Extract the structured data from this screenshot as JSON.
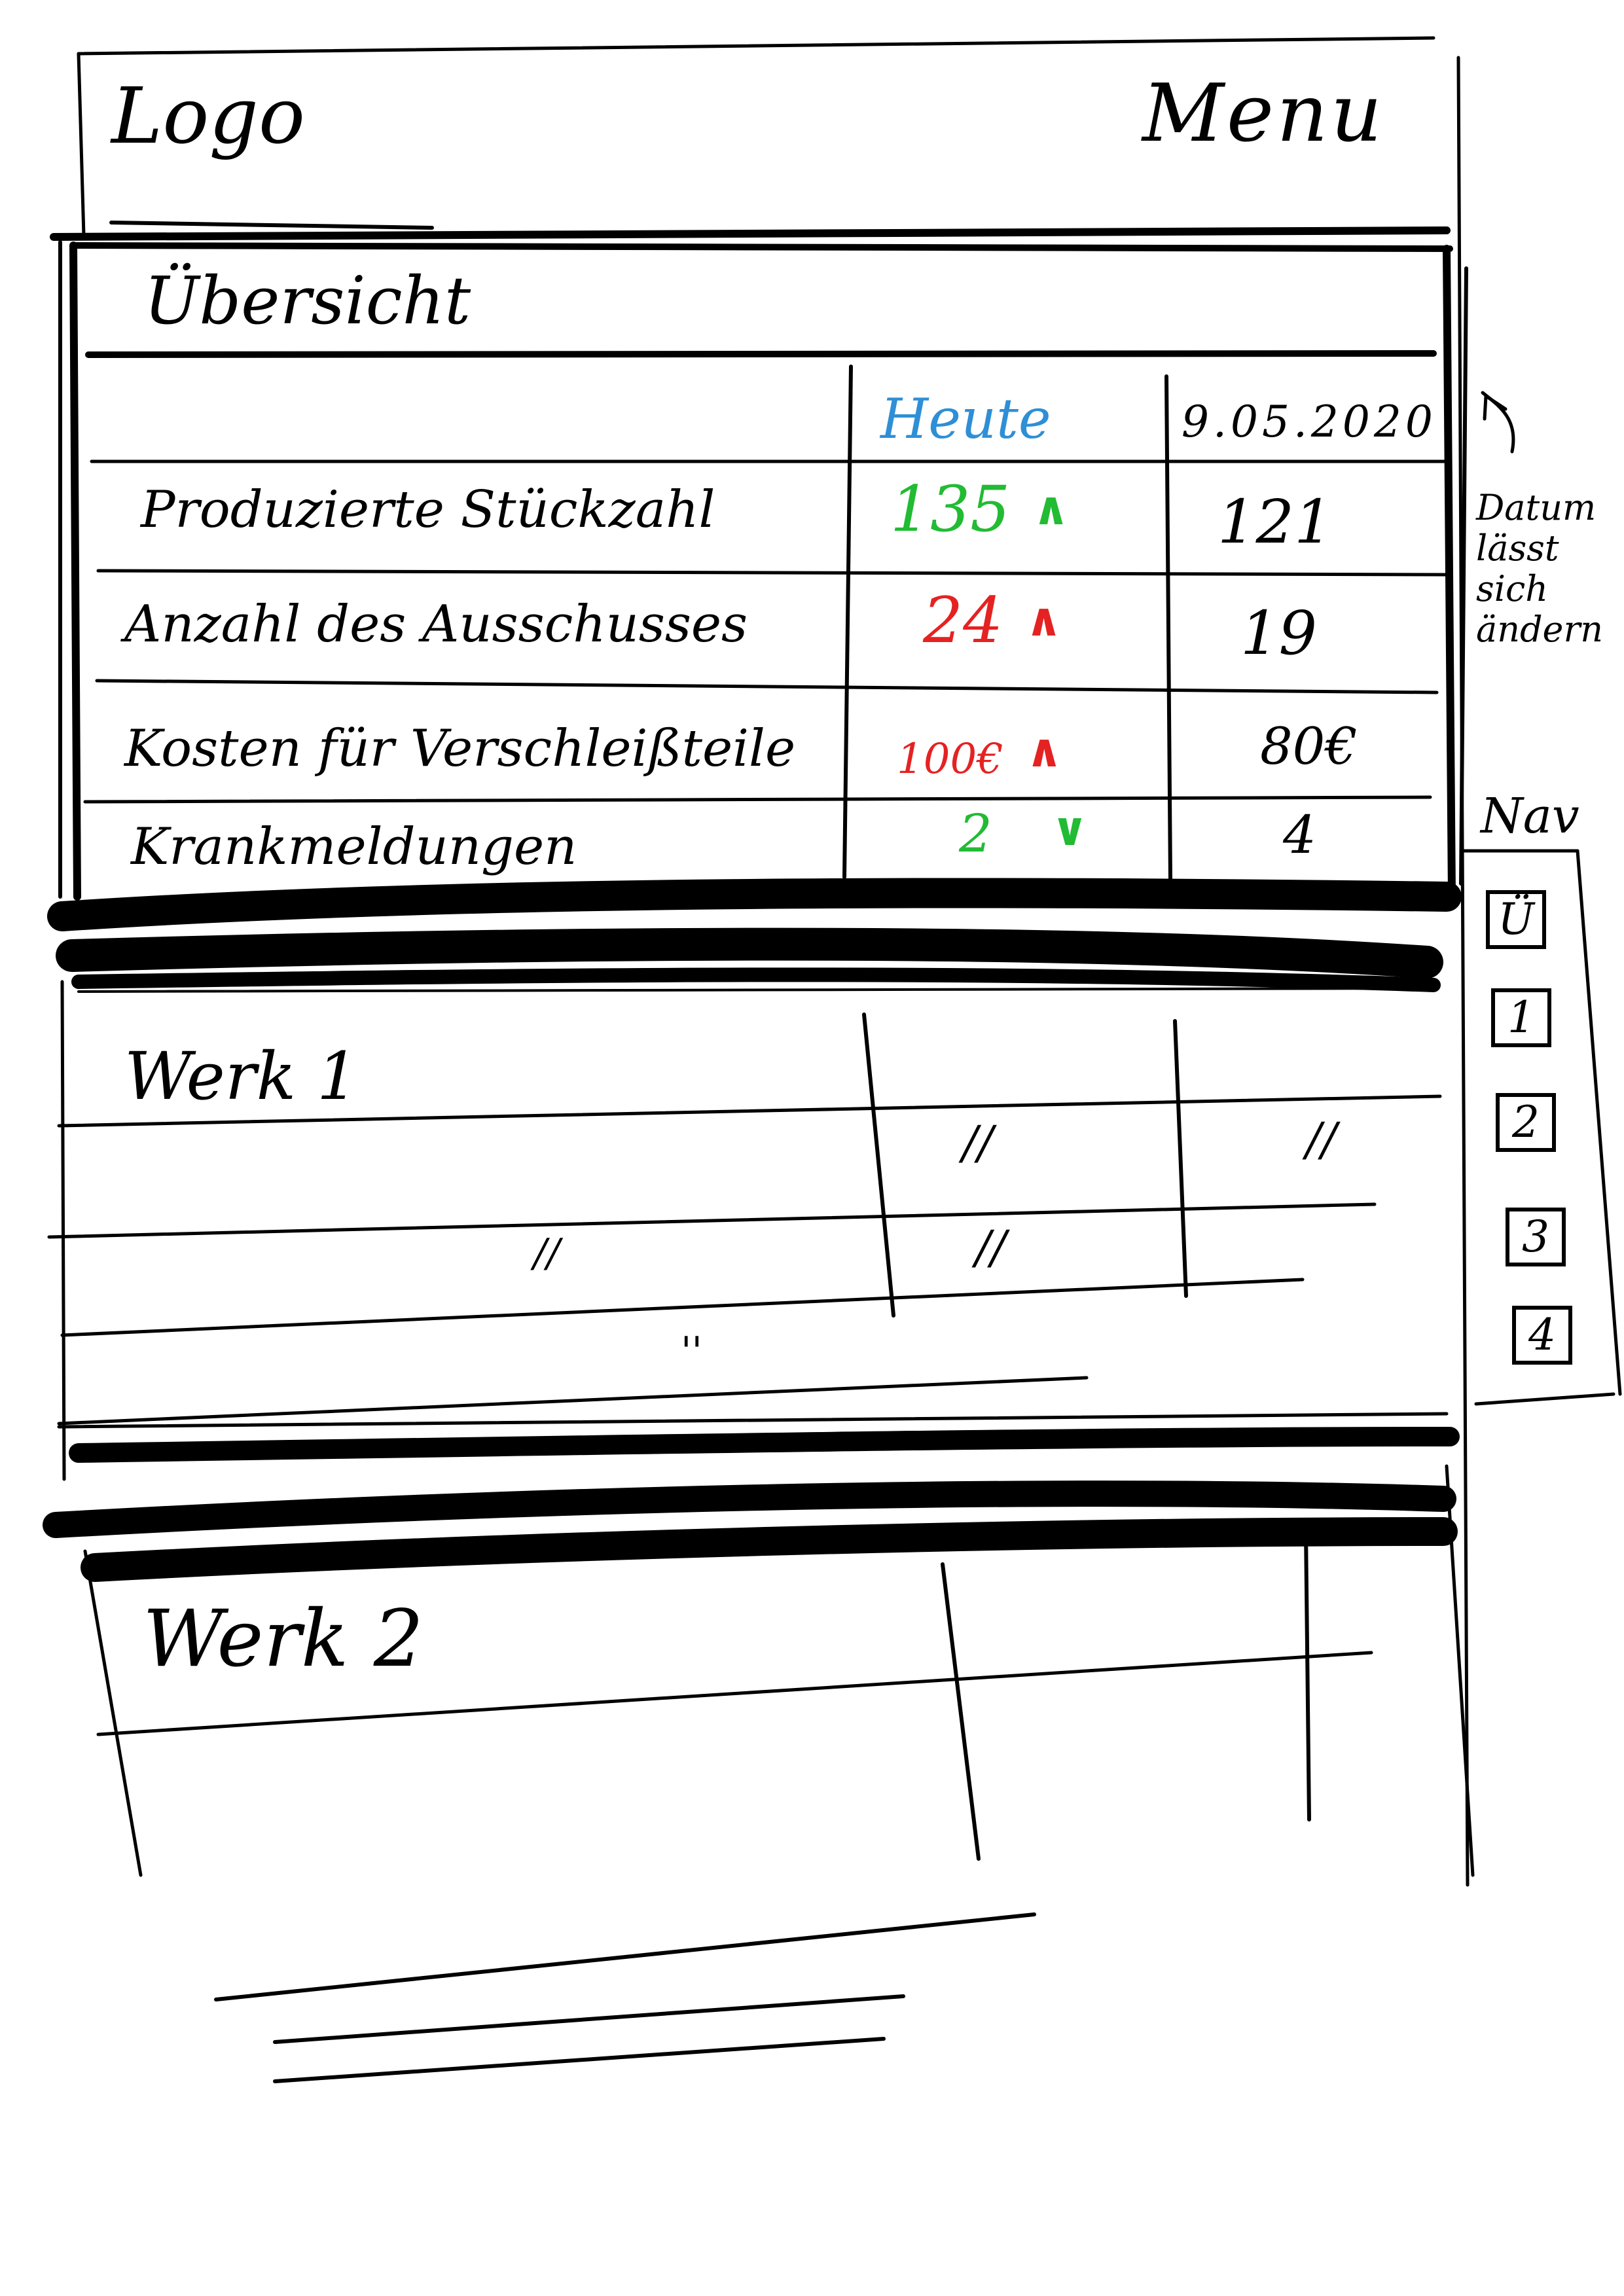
{
  "header": {
    "logo": "Logo",
    "menu": "Menu"
  },
  "overview": {
    "title": "Übersicht",
    "columns": {
      "today": "Heute",
      "date": "9.05.2020"
    },
    "rows": [
      {
        "label": "Produzierte Stückzahl",
        "today": "135",
        "trend": "up",
        "previous": "121"
      },
      {
        "label": "Anzahl des Ausschusses",
        "today": "24",
        "trend": "up",
        "previous": "19"
      },
      {
        "label": "Kosten für Verschleißteile",
        "today": "100€",
        "trend": "up",
        "previous": "80€"
      },
      {
        "label": "Krankmeldungen",
        "today": "2",
        "trend": "down",
        "previous": "4"
      }
    ],
    "date_note": "Datum lässt sich ändern"
  },
  "nav": {
    "label": "Nav",
    "items": [
      "Ü",
      "1",
      "2",
      "3",
      "4"
    ]
  },
  "werk1": {
    "title": "Werk 1",
    "placeholders": [
      "//",
      "//",
      "//",
      "//",
      "''"
    ]
  },
  "werk2": {
    "title": "Werk 2"
  },
  "colors": {
    "good": "#22bb33",
    "bad": "#e52222",
    "heading_blue": "#2e8fd6",
    "ink": "#000000"
  },
  "icons": {
    "up": "chevron-up-icon",
    "down": "chevron-down-icon"
  }
}
